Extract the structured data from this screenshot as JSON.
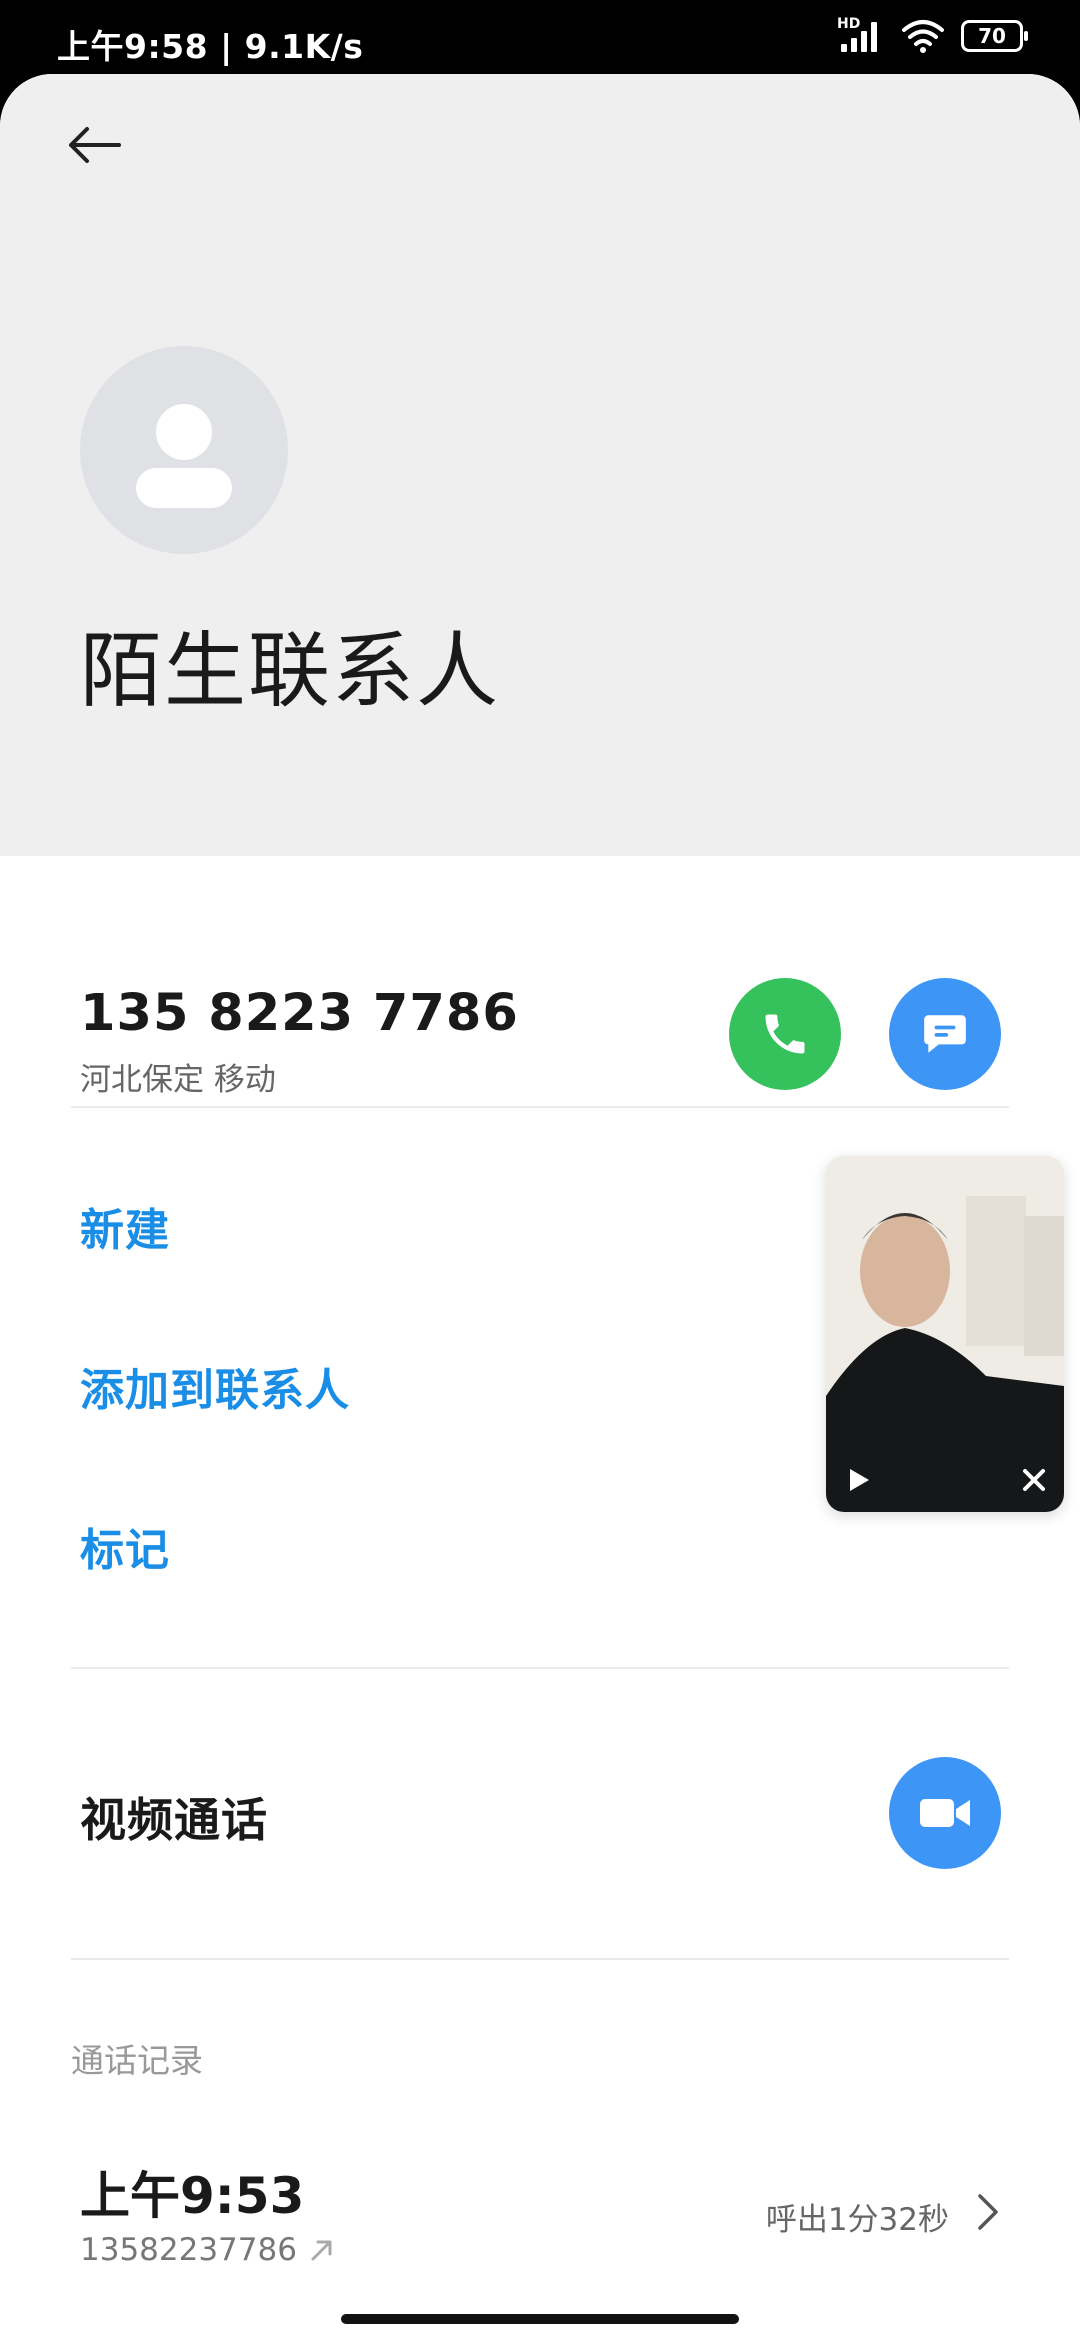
{
  "status_bar": {
    "time_speed": "上午9:58 | 9.1K/s",
    "network_badge": "HD",
    "battery_level": "70",
    "icons": [
      "signal-icon",
      "wifi-icon",
      "battery-icon"
    ]
  },
  "header": {
    "back_icon": "arrow-left-icon",
    "avatar_icon": "person-icon",
    "name": "陌生联系人"
  },
  "phone": {
    "number": "135 8223 7786",
    "location": "河北保定 移动",
    "call_icon": "phone-icon",
    "message_icon": "message-icon"
  },
  "actions": {
    "new": "新建",
    "add_to_contacts": "添加到联系人",
    "mark": "标记"
  },
  "video_call": {
    "label": "视频通话",
    "icon": "video-camera-icon"
  },
  "call_log": {
    "title": "通话记录",
    "entries": [
      {
        "time": "上午9:53",
        "number": "13582237786",
        "direction_icon": "outgoing-arrow-icon",
        "duration": "呼出1分32秒"
      }
    ]
  },
  "floating_video": {
    "play_icon": "play-icon",
    "close_icon": "close-icon"
  },
  "colors": {
    "accent_blue": "#3d96f6",
    "link_blue": "#1a8ee6",
    "call_green": "#35c25c",
    "header_bg": "#efefef"
  }
}
